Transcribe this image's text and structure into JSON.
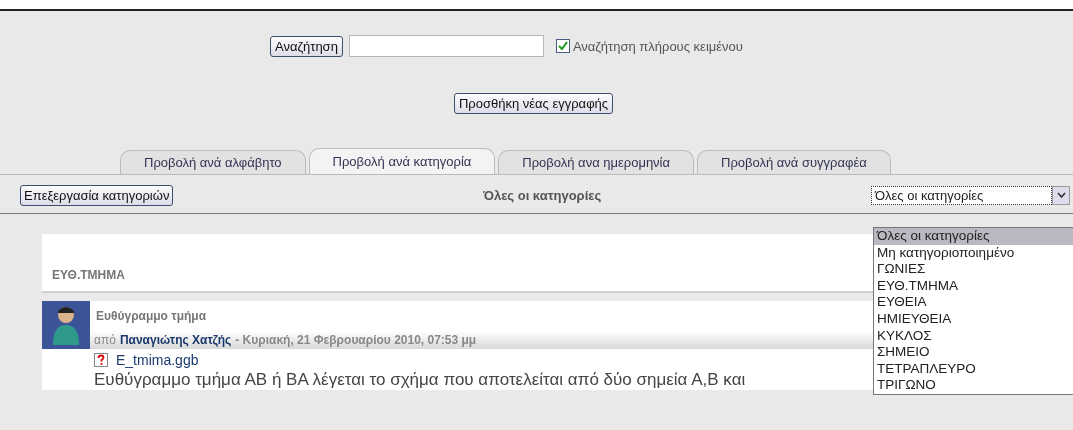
{
  "search": {
    "button": "Αναζήτηση",
    "fulltext": {
      "label": "Αναζήτηση πλήρους κειμένου",
      "checked": true
    }
  },
  "add_button": "Προσθήκη νέας εγγραφής",
  "tabs": [
    {
      "label": "Προβολή ανά αλφάβητο",
      "selected": false
    },
    {
      "label": "Προβολή ανά κατηγορία",
      "selected": true
    },
    {
      "label": "Προβολή ανα ημερομηνία",
      "selected": false
    },
    {
      "label": "Προβολή ανά συγγραφέα",
      "selected": false
    }
  ],
  "toolbar": {
    "edit_button": "Επεξεργασία κατηγοριών",
    "heading": "Όλες οι κατηγορίες"
  },
  "category_select": {
    "value": "Όλες οι κατηγορίες",
    "expanded": true,
    "options": [
      {
        "label": "Όλες οι κατηγορίες",
        "selected": true
      },
      {
        "label": "Μη κατηγοριοποιημένο",
        "selected": false
      },
      {
        "label": "ΓΩΝΙΕΣ",
        "selected": false
      },
      {
        "label": "ΕΥΘ.ΤΜΗΜΑ",
        "selected": false
      },
      {
        "label": "ΕΥΘΕΙΑ",
        "selected": false
      },
      {
        "label": "ΗΜΙΕΥΘΕΙΑ",
        "selected": false
      },
      {
        "label": "ΚΥΚΛΟΣ",
        "selected": false
      },
      {
        "label": "ΣΗΜΕΙΟ",
        "selected": false
      },
      {
        "label": "ΤΕΤΡΑΠΛΕΥΡΟ",
        "selected": false
      },
      {
        "label": "ΤΡΙΓΩΝΟ",
        "selected": false
      }
    ]
  },
  "category": "ΕΥΘ.ΤΜΗΜΑ",
  "entry": {
    "title": "Ευθύγραμμο τμήμα",
    "byline_prefix": "από",
    "author": "Παναγιώτης Χατζής",
    "date": "- Κυριακή, 21 Φεβρουαρίου 2010, 07:53 μμ",
    "attachment": "E_tmima.ggb",
    "body": "Ευθύγραμμο τμήμα ΑΒ ή ΒΑ λέγεται το σχήμα που αποτελείται από δύο σημεία Α,Β και"
  }
}
